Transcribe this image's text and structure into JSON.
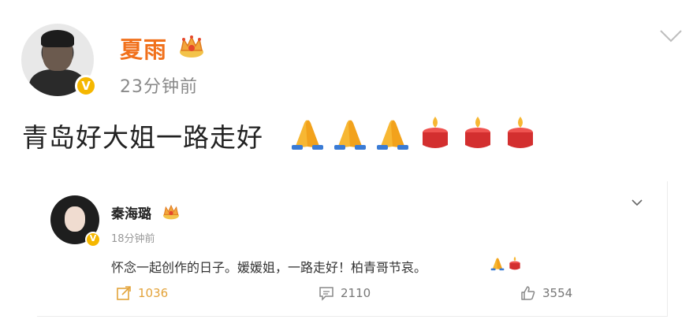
{
  "post": {
    "author": "夏雨",
    "time": "23分钟前",
    "text": "青岛好大姐一路走好",
    "emojis": [
      "pray-emoji",
      "pray-emoji",
      "pray-emoji",
      "candle-emoji",
      "candle-emoji",
      "candle-emoji"
    ]
  },
  "repost": {
    "author": "秦海璐",
    "time": "18分钟前",
    "text": "怀念一起创作的日子。媛媛姐，一路走好！柏青哥节哀。",
    "emojis": [
      "pray-emoji",
      "candle-emoji"
    ],
    "actions": {
      "repost_count": "1036",
      "comment_count": "2110",
      "like_count": "3554"
    }
  },
  "colors": {
    "name_orange": "#f1711c",
    "verify_gold": "#f5b700",
    "repost_accent": "#e3a33a"
  }
}
